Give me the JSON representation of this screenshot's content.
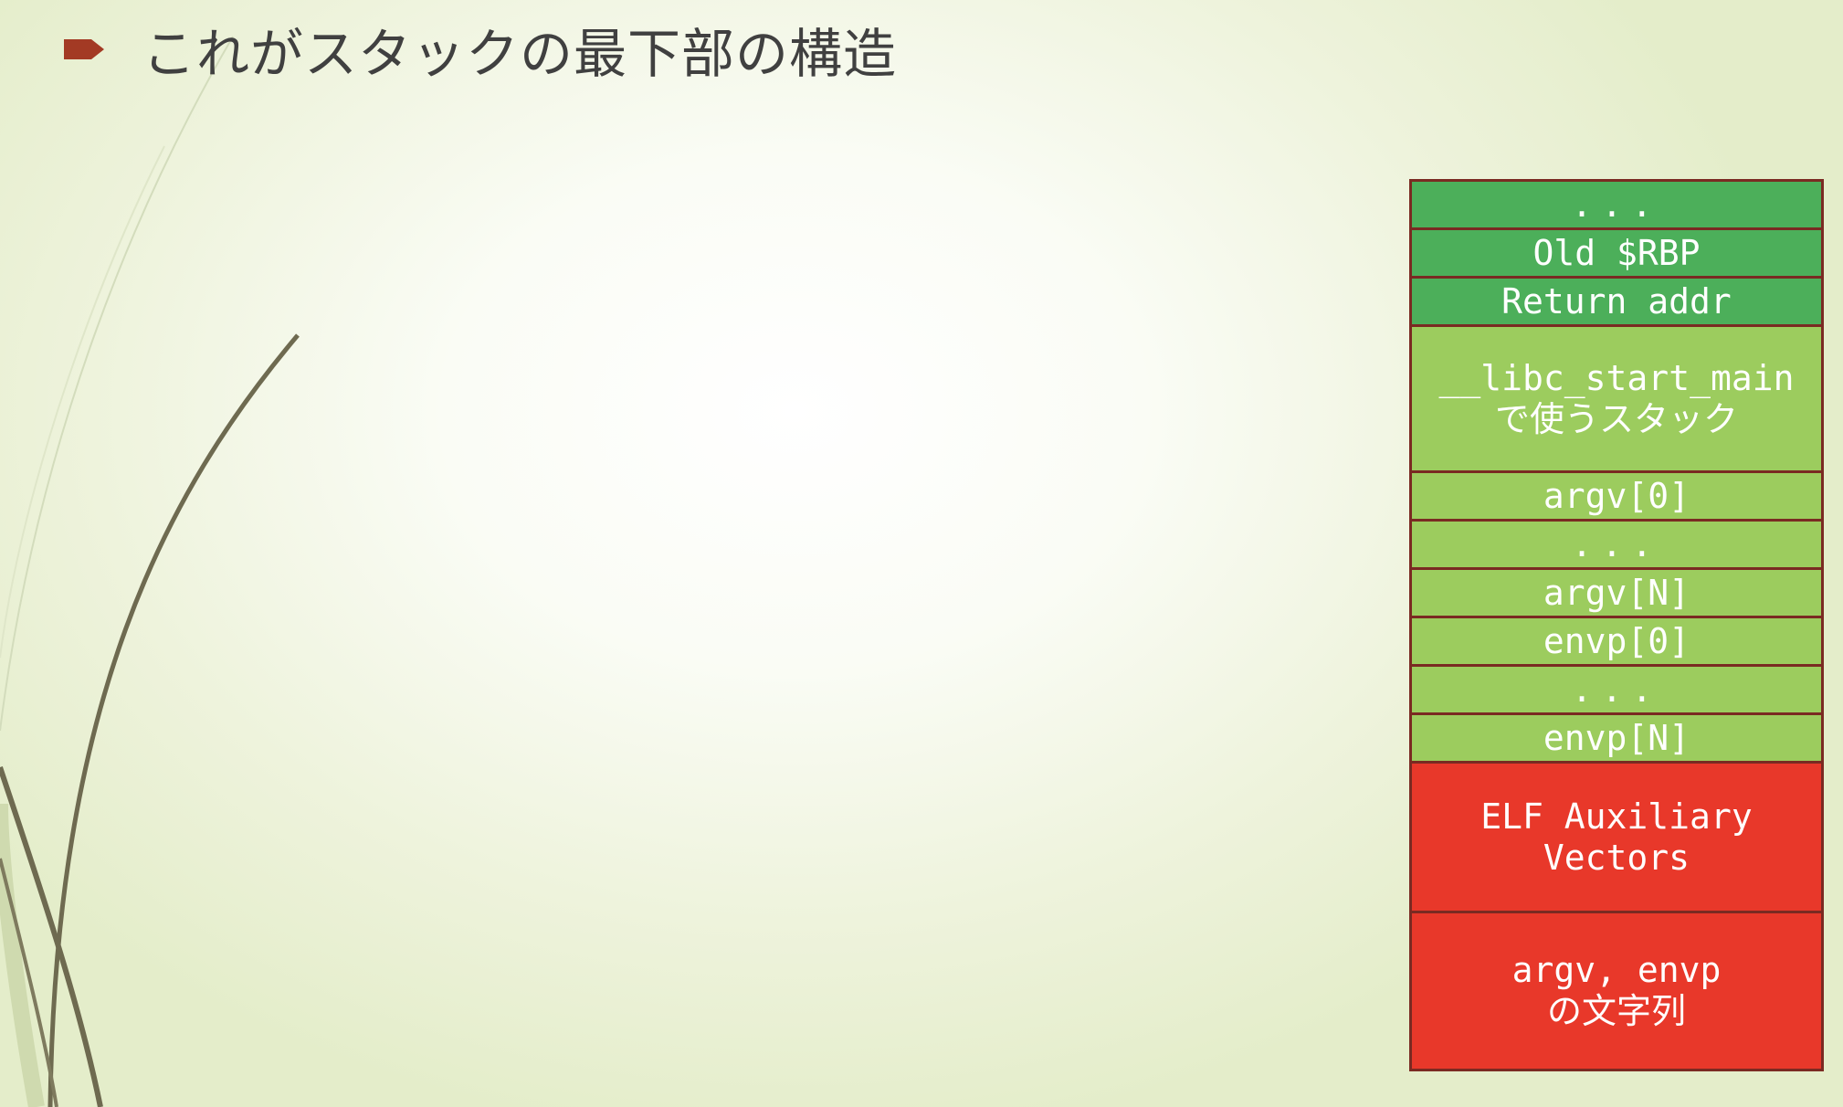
{
  "slide": {
    "title": "これがスタックの最下部の構造",
    "bullet_icon": "arrow-bullet-icon",
    "colors": {
      "dark_green": "#4caf5a",
      "light_green": "#9ccc5e",
      "red": "#e8382a",
      "border": "#7a2a22",
      "title_text": "#404040",
      "bullet": "#a33a24"
    }
  },
  "stack": {
    "cells": [
      {
        "label": "...",
        "kind": "dark_green",
        "size": "sm"
      },
      {
        "label": "Old $RBP",
        "kind": "dark_green",
        "size": "sm"
      },
      {
        "label": "Return addr",
        "kind": "dark_green",
        "size": "sm"
      },
      {
        "label": "__libc_start_main\nで使うスタック",
        "kind": "light_green",
        "size": "lg"
      },
      {
        "label": "argv[0]",
        "kind": "light_green",
        "size": "sm"
      },
      {
        "label": "...",
        "kind": "light_green",
        "size": "sm"
      },
      {
        "label": "argv[N]",
        "kind": "light_green",
        "size": "sm"
      },
      {
        "label": "envp[0]",
        "kind": "light_green",
        "size": "sm"
      },
      {
        "label": "...",
        "kind": "light_green",
        "size": "sm"
      },
      {
        "label": "envp[N]",
        "kind": "light_green",
        "size": "sm"
      },
      {
        "label": "ELF Auxiliary\nVectors",
        "kind": "red",
        "size": "lg"
      },
      {
        "label": "argv, envp\nの文字列",
        "kind": "red",
        "size": "lg"
      }
    ]
  }
}
